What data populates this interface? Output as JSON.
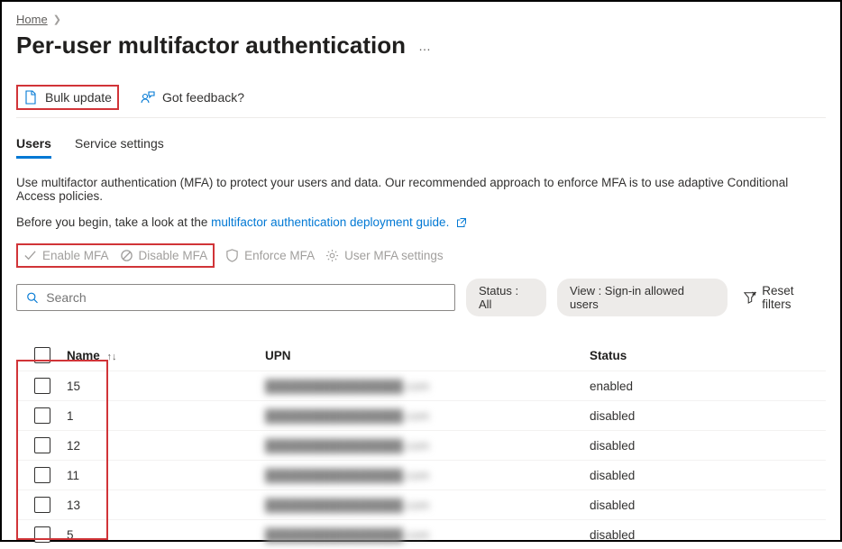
{
  "breadcrumb": {
    "home": "Home"
  },
  "page": {
    "title": "Per-user multifactor authentication",
    "more_menu": "…"
  },
  "toolbar": {
    "bulk_update": "Bulk update",
    "feedback": "Got feedback?"
  },
  "tabs": {
    "users": "Users",
    "service_settings": "Service settings"
  },
  "info": {
    "description": "Use multifactor authentication (MFA) to protect your users and data. Our recommended approach to enforce MFA is to use adaptive Conditional Access policies.",
    "before_begin_prefix": "Before you begin, take a look at the ",
    "guide_link": "multifactor authentication deployment guide."
  },
  "mfa_actions": {
    "enable": "Enable MFA",
    "disable": "Disable MFA",
    "enforce": "Enforce MFA",
    "settings": "User MFA settings"
  },
  "search": {
    "placeholder": "Search"
  },
  "filters": {
    "status_pill": "Status : All",
    "view_pill": "View : Sign-in allowed users",
    "reset": "Reset filters"
  },
  "table": {
    "headers": {
      "name": "Name",
      "upn": "UPN",
      "status": "Status"
    },
    "rows": [
      {
        "name": "15",
        "upn": "████████████████.com",
        "status": "enabled"
      },
      {
        "name": "1",
        "upn": "████████████████.com",
        "status": "disabled"
      },
      {
        "name": "12",
        "upn": "████████████████.com",
        "status": "disabled"
      },
      {
        "name": "11",
        "upn": "████████████████.com",
        "status": "disabled"
      },
      {
        "name": "13",
        "upn": "████████████████.com",
        "status": "disabled"
      },
      {
        "name": "5",
        "upn": "████████████████.com",
        "status": "disabled"
      }
    ]
  }
}
